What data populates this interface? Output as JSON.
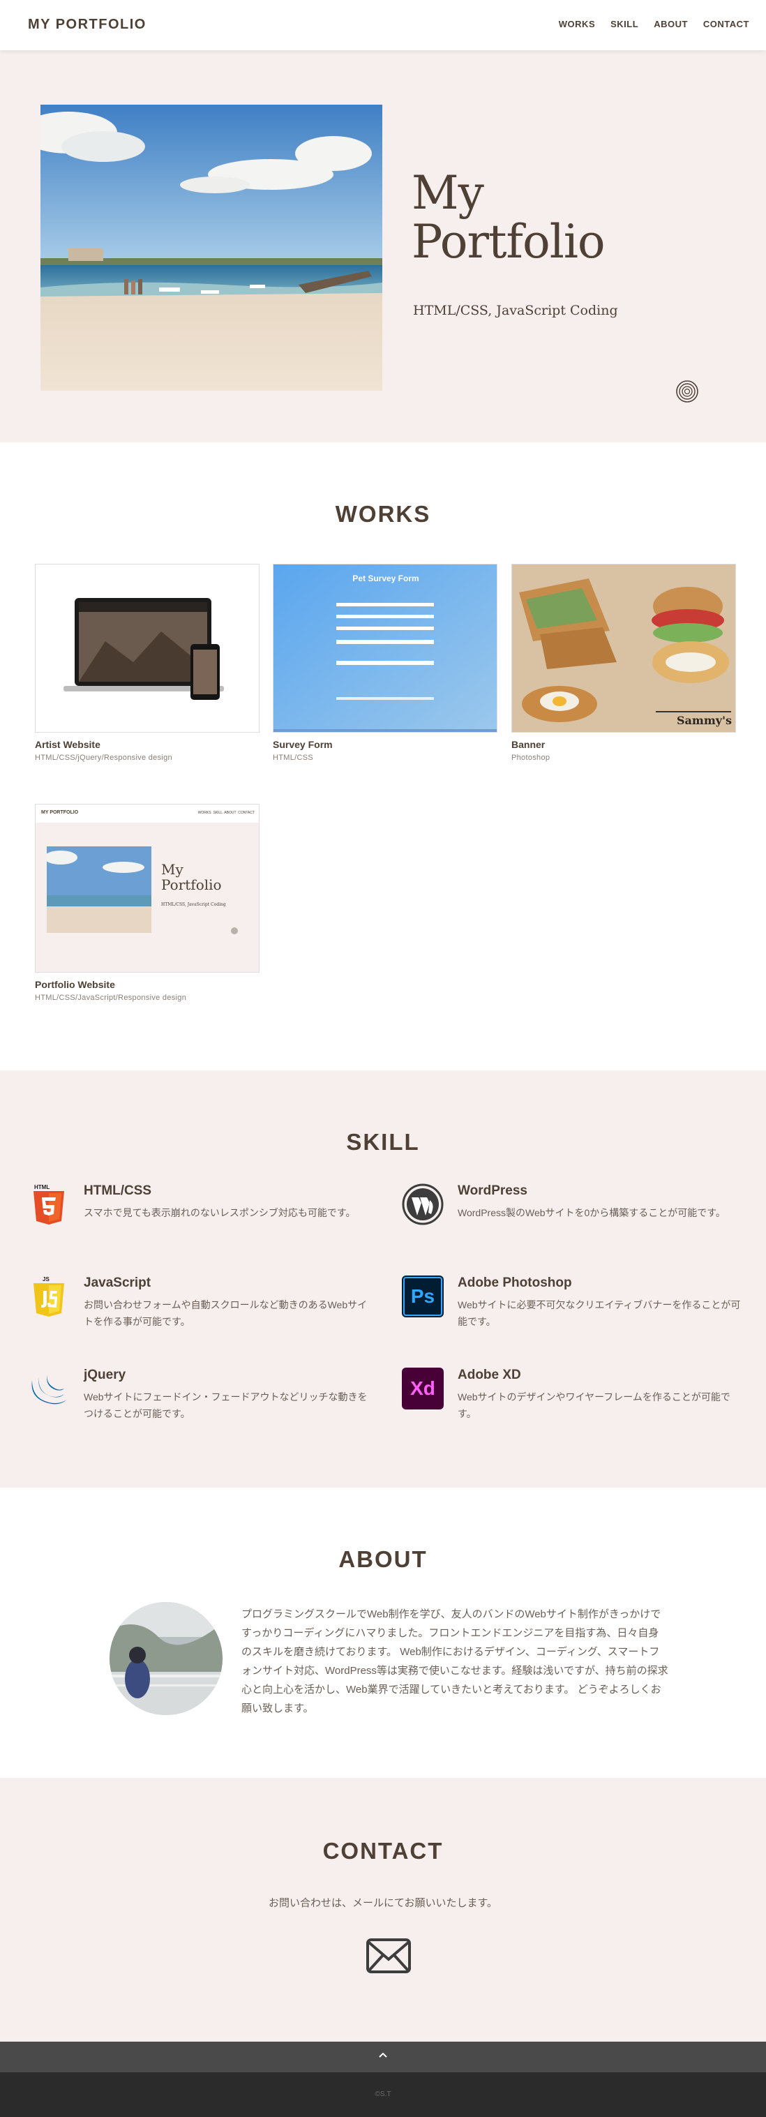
{
  "header": {
    "logo": "MY PORTFOLIO",
    "nav": [
      "WORKS",
      "SKILL",
      "ABOUT",
      "CONTACT"
    ]
  },
  "hero": {
    "title_line1": "My",
    "title_line2": "Portfolio",
    "subtitle": "HTML/CSS, JavaScript Coding"
  },
  "works": {
    "title": "WORKS",
    "items": [
      {
        "name": "Artist Website",
        "tech": "HTML/CSS/jQuery/Responsive design"
      },
      {
        "name": "Survey Form",
        "tech": "HTML/CSS",
        "thumb_title": "Pet Survey Form"
      },
      {
        "name": "Banner",
        "tech": "Photoshop",
        "thumb_brand": "Sammy's"
      },
      {
        "name": "Portfolio Website",
        "tech": "HTML/CSS/JavaScript/Responsive design"
      }
    ],
    "mini_portfolio": {
      "logo": "MY PORTFOLIO",
      "nav": "WORKS  SKILL  ABOUT  CONTACT",
      "title_line1": "My",
      "title_line2": "Portfolio",
      "subtitle": "HTML/CSS, JavaScript Coding"
    }
  },
  "skill": {
    "title": "SKILL",
    "items": [
      {
        "name": "HTML/CSS",
        "desc": "スマホで見ても表示崩れのないレスポンシブ対応も可能です。",
        "icon": "html5-icon"
      },
      {
        "name": "WordPress",
        "desc": "WordPress製のWebサイトを0から構築することが可能です。",
        "icon": "wordpress-icon"
      },
      {
        "name": "JavaScript",
        "desc": "お問い合わせフォームや自動スクロールなど動きのあるWebサイトを作る事が可能です。",
        "icon": "javascript-icon"
      },
      {
        "name": "Adobe Photoshop",
        "desc": "Webサイトに必要不可欠なクリエイティブバナーを作ることが可能です。",
        "icon": "photoshop-icon",
        "icon_text": "Ps"
      },
      {
        "name": "jQuery",
        "desc": "Webサイトにフェードイン・フェードアウトなどリッチな動きをつけることが可能です。",
        "icon": "jquery-icon"
      },
      {
        "name": "Adobe XD",
        "desc": "Webサイトのデザインやワイヤーフレームを作ることが可能です。",
        "icon": "xd-icon",
        "icon_text": "Xd"
      }
    ],
    "html5_badge": "HTML",
    "js_badge": "JS"
  },
  "about": {
    "title": "ABOUT",
    "text": "プログラミングスクールでWeb制作を学び、友人のバンドのWebサイト制作がきっかけですっかりコーディングにハマりました。フロントエンドエンジニアを目指す為、日々自身のスキルを磨き続けております。 Web制作におけるデザイン、コーディング、スマートフォンサイト対応、WordPress等は実務で使いこなせます。経験は浅いですが、持ち前の探求心と向上心を活かし、Web業界で活躍していきたいと考えております。 どうぞよろしくお願い致します。"
  },
  "contact": {
    "title": "CONTACT",
    "text": "お問い合わせは、メールにてお願いいたします。"
  },
  "footer": {
    "copyright": "©S.T"
  },
  "colors": {
    "text": "#4e4034",
    "section_bg": "#f6efee",
    "footer_bar": "#4a4a4a",
    "footer_bg": "#2b2b2b"
  }
}
